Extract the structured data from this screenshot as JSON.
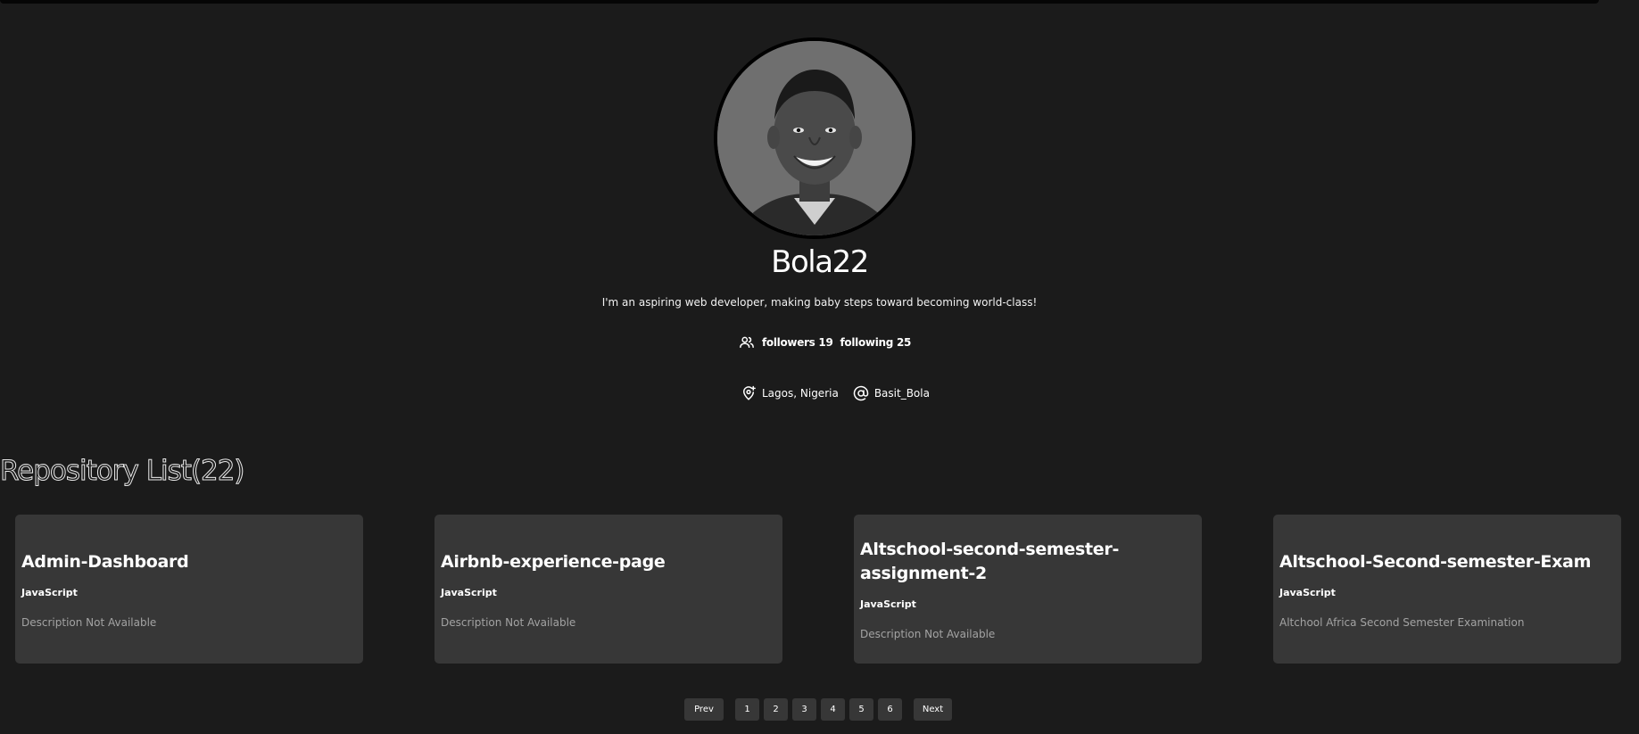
{
  "profile": {
    "username": "Bola22",
    "bio": "I'm an aspiring web developer, making baby steps toward becoming world-class!",
    "followers_text": "followers 19",
    "following_text": "following 25",
    "location": "Lagos, Nigeria",
    "twitter": "Basit_Bola",
    "icons": {
      "people": "people-icon",
      "location": "location-pin-icon",
      "at": "at-sign-icon"
    }
  },
  "repositories": {
    "heading": "Repository List(22)",
    "items": [
      {
        "name": "Admin-Dashboard",
        "language": "JavaScript",
        "description": "Description Not Available"
      },
      {
        "name": "Airbnb-experience-page",
        "language": "JavaScript",
        "description": "Description Not Available"
      },
      {
        "name": "Altschool-second-semester-assignment-2",
        "language": "JavaScript",
        "description": "Description Not Available"
      },
      {
        "name": "Altschool-Second-semester-Exam",
        "language": "JavaScript",
        "description": "Altchool Africa Second Semester Examination"
      }
    ]
  },
  "pagination": {
    "prev_label": "Prev",
    "next_label": "Next",
    "pages": [
      "1",
      "2",
      "3",
      "4",
      "5",
      "6"
    ]
  },
  "colors": {
    "background": "#1b1b1b",
    "card": "#373737",
    "muted_text": "#a3a3a3"
  }
}
